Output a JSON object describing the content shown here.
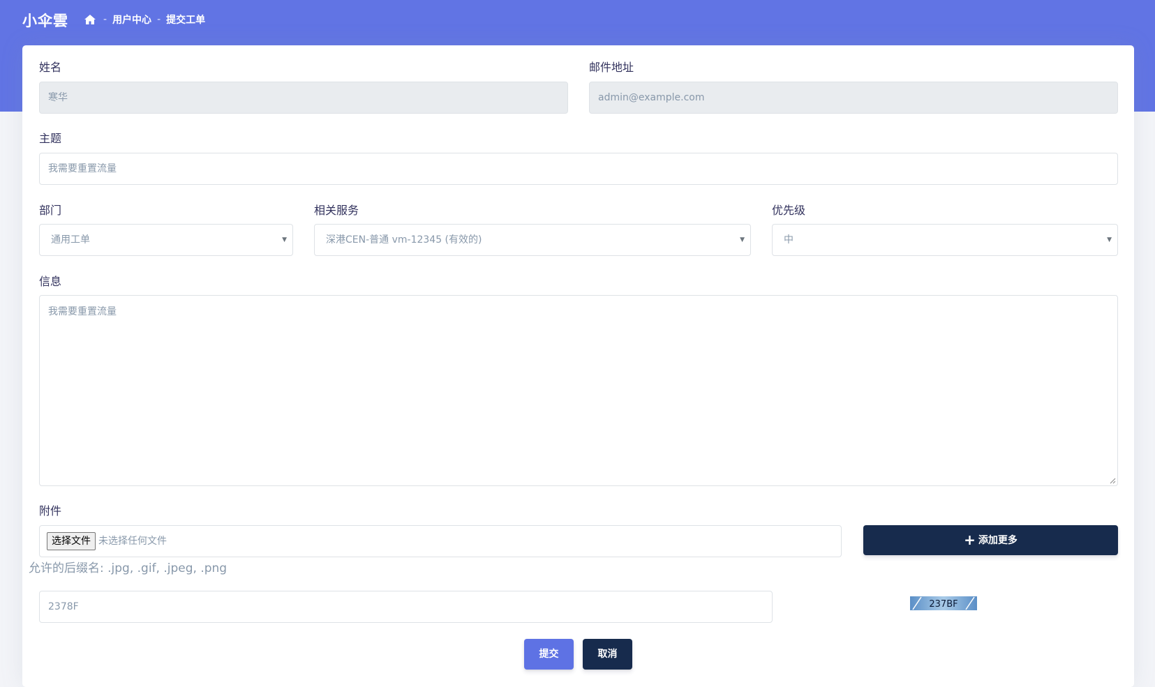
{
  "header": {
    "brand": "小伞雲",
    "breadcrumb": [
      "用户中心",
      "提交工单"
    ],
    "separator": "-"
  },
  "form": {
    "name": {
      "label": "姓名",
      "value": "寒华"
    },
    "email": {
      "label": "邮件地址",
      "value": "admin@example.com"
    },
    "subject": {
      "label": "主题",
      "value": "我需要重置流量"
    },
    "department": {
      "label": "部门",
      "value": "通用工单"
    },
    "service": {
      "label": "相关服务",
      "value": "深港CEN-普通 vm-12345 (有效的)"
    },
    "priority": {
      "label": "优先级",
      "value": "中"
    },
    "message": {
      "label": "信息",
      "value": "我需要重置流量"
    },
    "attachment": {
      "label": "附件",
      "choose_button": "选择文件",
      "status": "未选择任何文件",
      "add_more": "添加更多",
      "allowed_ext": "允许的后缀名: .jpg, .gif, .jpeg, .png"
    },
    "captcha": {
      "input_value": "2378F",
      "image_text": "237BF"
    },
    "submit_label": "提交",
    "cancel_label": "取消"
  },
  "colors": {
    "header_bg": "#6174e4",
    "primary": "#5e72e4",
    "dark": "#172b4d"
  },
  "icons": [
    "home-icon",
    "plus-icon",
    "chevron-down-icon",
    "resize-grip-icon"
  ]
}
